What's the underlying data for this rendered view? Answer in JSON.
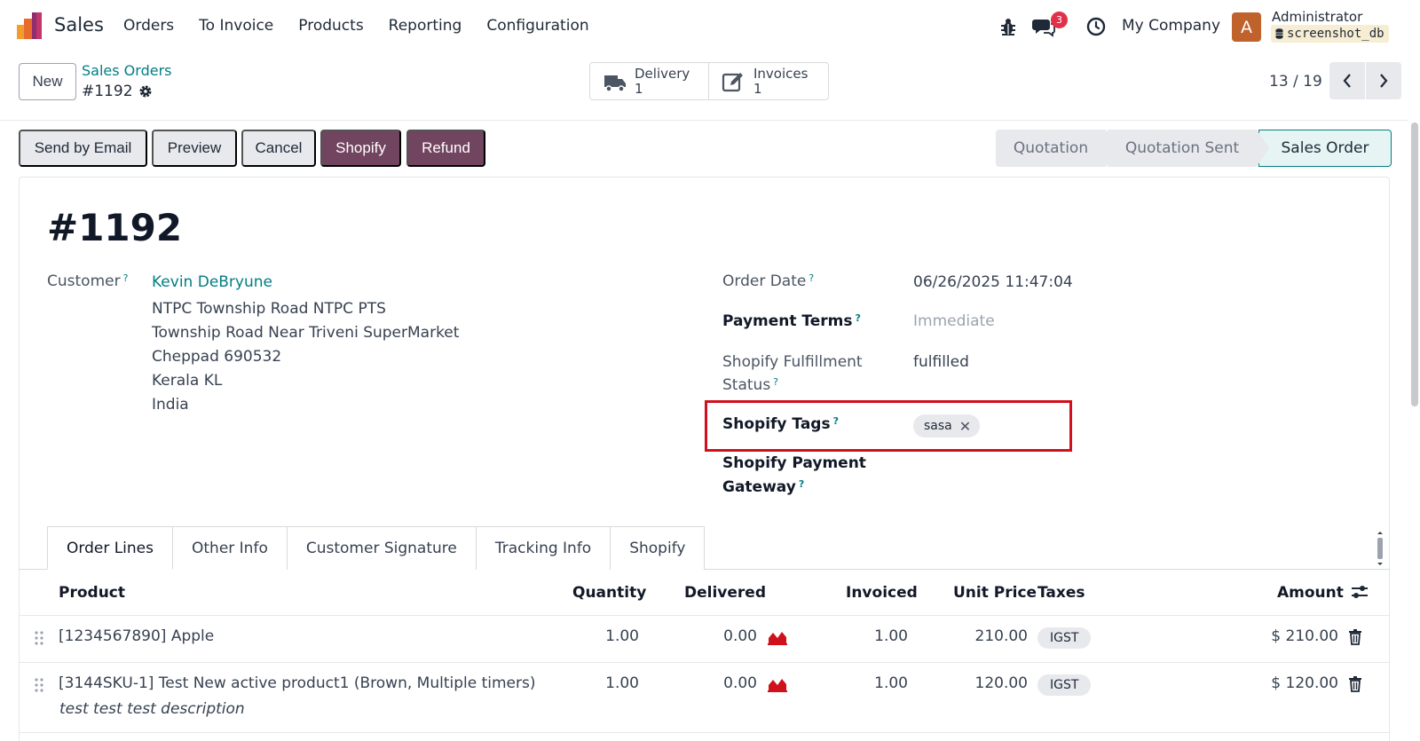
{
  "navbar": {
    "app_name": "Sales",
    "menu": [
      "Orders",
      "To Invoice",
      "Products",
      "Reporting",
      "Configuration"
    ],
    "chat_badge": "3",
    "company": "My Company",
    "avatar_letter": "A",
    "user_name": "Administrator",
    "db_name": "screenshot_db"
  },
  "control": {
    "new_label": "New",
    "breadcrumb": "Sales Orders",
    "record_ref": "#1192",
    "smart_buttons": [
      {
        "label": "Delivery",
        "count": "1"
      },
      {
        "label": "Invoices",
        "count": "1"
      }
    ],
    "pager": "13 / 19"
  },
  "actions": {
    "send_email": "Send by Email",
    "preview": "Preview",
    "cancel": "Cancel",
    "shopify": "Shopify",
    "refund": "Refund"
  },
  "statusbar": {
    "stages": [
      "Quotation",
      "Quotation Sent",
      "Sales Order"
    ],
    "current": "Sales Order"
  },
  "form": {
    "title": "#1192",
    "customer_label": "Customer",
    "customer_name": "Kevin DeBryune",
    "address": [
      "NTPC Township Road NTPC PTS",
      "Township Road Near Triveni SuperMarket",
      "Cheppad 690532",
      "Kerala KL",
      "India"
    ],
    "order_date_label": "Order Date",
    "order_date": "06/26/2025 11:47:04",
    "payment_terms_label": "Payment Terms",
    "payment_terms": "Immediate",
    "fulfillment_label_1": "Shopify Fulfillment",
    "fulfillment_label_2": "Status",
    "fulfillment_status": "fulfilled",
    "tags_label": "Shopify Tags",
    "tag": "sasa",
    "gateway_label_1": "Shopify Payment",
    "gateway_label_2": "Gateway",
    "help_mark": "?"
  },
  "tabs": [
    "Order Lines",
    "Other Info",
    "Customer Signature",
    "Tracking Info",
    "Shopify"
  ],
  "table": {
    "headers": {
      "product": "Product",
      "quantity": "Quantity",
      "delivered": "Delivered",
      "invoiced": "Invoiced",
      "unit_price": "Unit Price",
      "taxes": "Taxes",
      "amount": "Amount"
    },
    "rows": [
      {
        "product": "[1234567890] Apple",
        "quantity": "1.00",
        "delivered": "0.00",
        "invoiced": "1.00",
        "unit_price": "210.00",
        "tax": "IGST",
        "amount": "$ 210.00"
      },
      {
        "product": "[3144SKU-1] Test New active product1 (Brown, Multiple timers)",
        "quantity": "1.00",
        "delivered": "0.00",
        "invoiced": "1.00",
        "unit_price": "120.00",
        "tax": "IGST",
        "amount": "$ 120.00",
        "description": "test test test description"
      }
    ]
  },
  "colors": {
    "accent": "#017e84",
    "primary_button": "#71445f",
    "highlight_border": "#d0101a",
    "badge": "#e0314b"
  }
}
